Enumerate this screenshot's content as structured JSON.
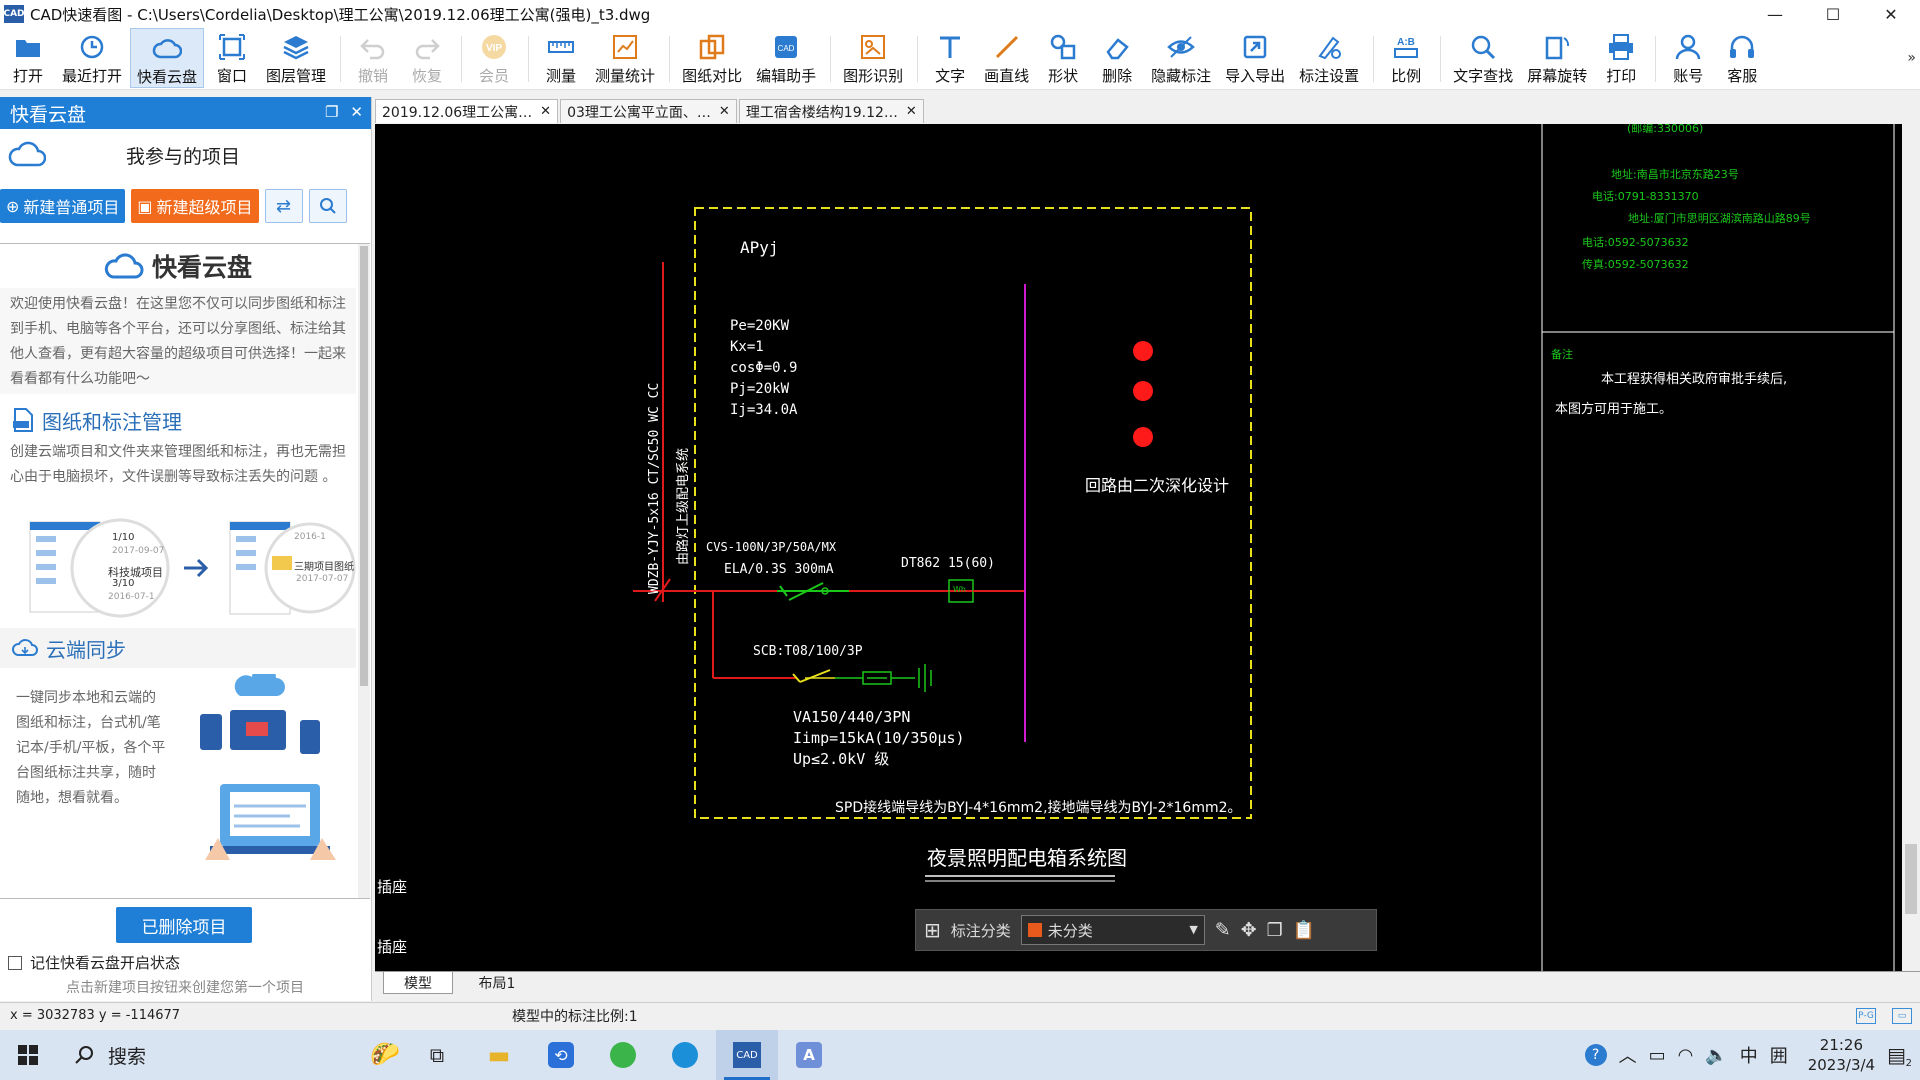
{
  "window": {
    "title": "CAD快速看图 - C:\\Users\\Cordelia\\Desktop\\理工公寓\\2019.12.06理工公寓(强电)_t3.dwg",
    "app_icon": "CAD",
    "controls": [
      "—",
      "☐",
      "✕"
    ]
  },
  "toolbar": {
    "buttons": [
      {
        "label": "打开",
        "icon": "folder-open-icon",
        "color": "#2b7bd0"
      },
      {
        "label": "最近打开",
        "icon": "clock-icon",
        "color": "#2b7bd0"
      },
      {
        "label": "快看云盘",
        "icon": "cloud-icon",
        "color": "#2b7bd0",
        "active": true
      },
      {
        "label": "窗口",
        "icon": "window-icon",
        "color": "#2b7bd0"
      },
      {
        "label": "图层管理",
        "icon": "layers-icon",
        "color": "#2b7bd0"
      },
      {
        "label": "撤销",
        "icon": "undo-icon",
        "color": "#888",
        "disabled": true
      },
      {
        "label": "恢复",
        "icon": "redo-icon",
        "color": "#888",
        "disabled": true
      },
      {
        "label": "会员",
        "icon": "vip-icon",
        "color": "#e7a21a",
        "disabled": true
      },
      {
        "label": "测量",
        "icon": "ruler-icon",
        "color": "#2b7bd0"
      },
      {
        "label": "测量统计",
        "icon": "measure-stats-icon",
        "color": "#e07b1c"
      },
      {
        "label": "图纸对比",
        "icon": "compare-icon",
        "color": "#e07b1c"
      },
      {
        "label": "编辑助手",
        "icon": "edit-assistant-icon",
        "color": "#2b7bd0"
      },
      {
        "label": "图形识别",
        "icon": "shape-recognize-icon",
        "color": "#e07b1c"
      },
      {
        "label": "文字",
        "icon": "text-icon",
        "color": "#2b7bd0"
      },
      {
        "label": "画直线",
        "icon": "line-icon",
        "color": "#e07b1c"
      },
      {
        "label": "形状",
        "icon": "shape-icon",
        "color": "#2b7bd0"
      },
      {
        "label": "删除",
        "icon": "eraser-icon",
        "color": "#2b7bd0"
      },
      {
        "label": "隐藏标注",
        "icon": "hide-eye-icon",
        "color": "#2b7bd0"
      },
      {
        "label": "导入导出",
        "icon": "import-export-icon",
        "color": "#2b7bd0"
      },
      {
        "label": "标注设置",
        "icon": "annotation-settings-icon",
        "color": "#2b7bd0"
      },
      {
        "label": "比例",
        "icon": "scale-icon",
        "color": "#2b7bd0"
      },
      {
        "label": "文字查找",
        "icon": "text-search-icon",
        "color": "#2b7bd0"
      },
      {
        "label": "屏幕旋转",
        "icon": "rotate-screen-icon",
        "color": "#2b7bd0"
      },
      {
        "label": "打印",
        "icon": "printer-icon",
        "color": "#2b7bd0"
      },
      {
        "label": "账号",
        "icon": "user-icon",
        "color": "#2b7bd0"
      },
      {
        "label": "客服",
        "icon": "headset-icon",
        "color": "#2b7bd0"
      }
    ],
    "more": "»"
  },
  "left_panel": {
    "header": "快看云盘",
    "project_title": "我参与的项目",
    "new_normal": "新建普通项目",
    "new_super": "新建超级项目",
    "brand_title": "快看云盘",
    "intro": "欢迎使用快看云盘！在这里您不仅可以同步图纸和标注到手机、电脑等各个平台，还可以分享图纸、标注给其他人查看，更有超大容量的超级项目可供选择！一起来看看都有什么功能吧～",
    "sec1_title": "图纸和标注管理",
    "sec1_text": "创建云端项目和文件夹来管理图纸和标注，再也无需担心由于电脑损坏，文件误删等导致标注丢失的问题 。",
    "illus1": {
      "left_a": "1/10",
      "left_a_date": "2017-09-07",
      "left_b": "科技城项目",
      "left_b_count": "3/10",
      "left_b_date": "2016-07-1",
      "right_date1": "2016-1",
      "right_name": "三期项目图纸",
      "right_date2": "2017-07-07"
    },
    "sec2_title": "云端同步",
    "sec2_text": "一键同步本地和云端的图纸和标注，台式机/笔记本/手机/平板，各个平台图纸标注共享，随时随地，想看就看。",
    "deleted_btn": "已删除项目",
    "remember": "记住快看云盘开启状态",
    "hint": "点击新建项目按钮来创建您第一个项目"
  },
  "tabs": [
    {
      "label": "2019.12.06理工公寓…",
      "active": true
    },
    {
      "label": "03理工公寓平立面、…",
      "active": false
    },
    {
      "label": "理工宿舍楼结构19.12…",
      "active": false
    }
  ],
  "drawing": {
    "box_name": "APyj",
    "params": [
      "Pe=20KW",
      "Kx=1",
      "cosΦ=0.9",
      "Pj=20kW",
      "Ij=34.0A"
    ],
    "cable_vertical": "WDZB-YJY-5x16  CT/SC50  WC  CC",
    "incoming_note": "由路灯上级配电系统",
    "breaker_line1": "CVS-100N/3P/50A/MX",
    "breaker_line2": "ELA/0.3S  300mA",
    "meter": "DT862  15(60)",
    "meter_box": "Wh",
    "spd_breaker": "SCB:T08/100/3P",
    "spd_lines": [
      "VA150/440/3PN",
      "Iimp=15kA(10/350μs)",
      "Up≤2.0kV 级"
    ],
    "circuit_note": "回路由二次深化设计",
    "spd_note": "SPD接线端导线为BYJ-4*16mm2,接地端导线为BYJ-2*16mm2。",
    "diagram_title": "夜景照明配电箱系统图",
    "side_label_1": "插座",
    "side_label_2": "插座",
    "right_block": {
      "top_cut": "(邮编:330006)",
      "green_lines": [
        "地址:南昌市北京东路23号",
        "电话:0791-8331370",
        "地址:厦门市思明区湖滨南路山路89号",
        "电话:0592-5073632",
        "传真:0592-5073632"
      ],
      "note_label": "备注",
      "notes": [
        "本工程获得相关政府审批手续后,",
        "本图方可用于施工。"
      ]
    }
  },
  "annotation_bar": {
    "label": "标注分类",
    "category": "未分类",
    "category_color": "#e85a1b"
  },
  "layout_tabs": [
    "模型",
    "布局1"
  ],
  "status": {
    "coords": "x = 3032783  y = -114677",
    "scale": "模型中的标注比例:1"
  },
  "taskbar": {
    "search": "搜索",
    "ime": "中",
    "time": "21:26",
    "date": "2023/3/4",
    "notif": "2"
  }
}
